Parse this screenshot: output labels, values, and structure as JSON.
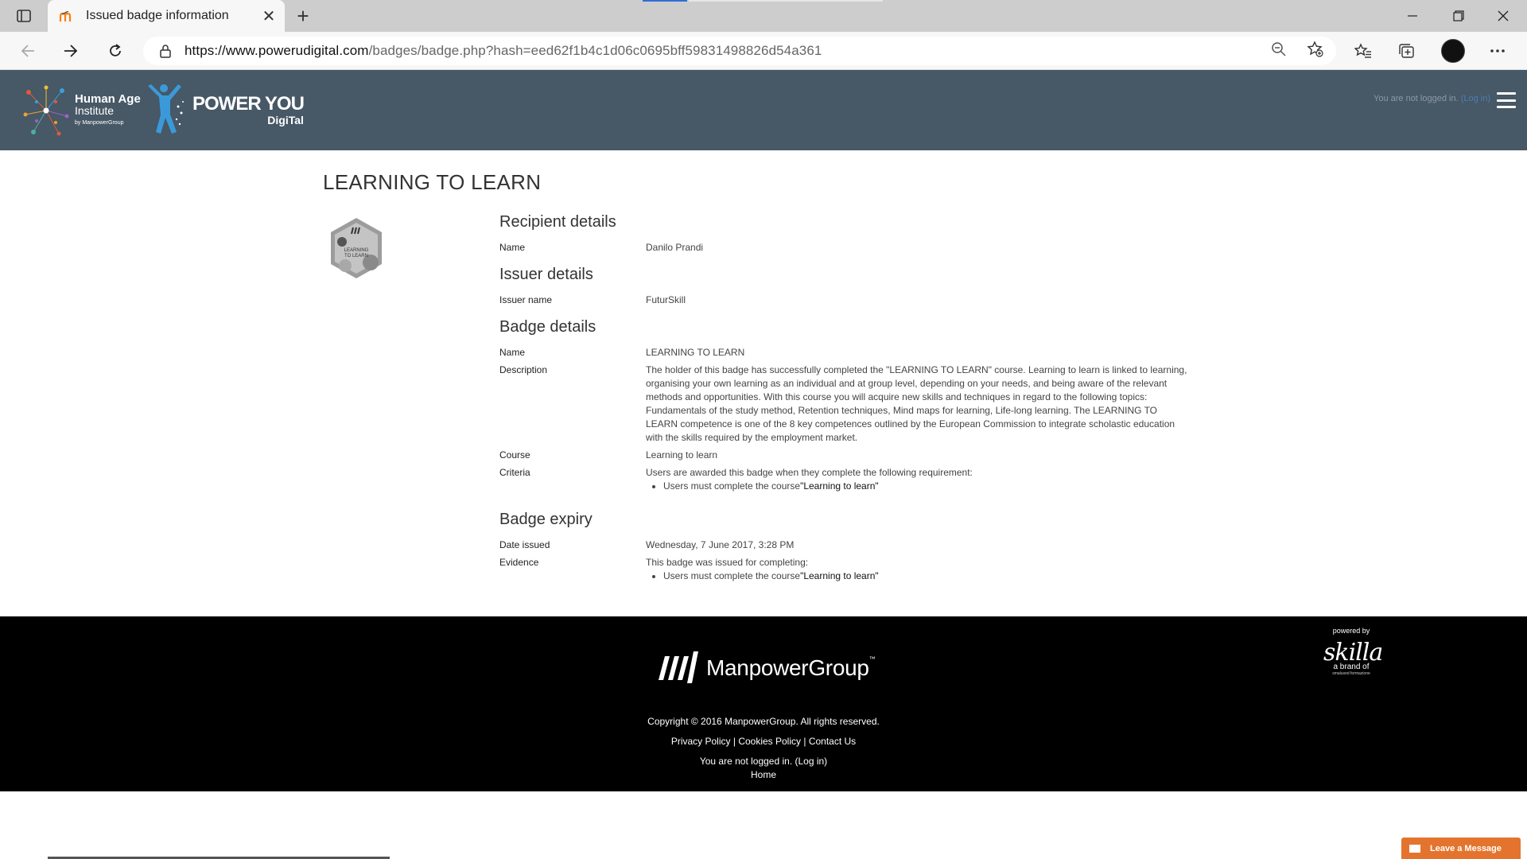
{
  "browser": {
    "tab_title": "Issued badge information",
    "url_host": "https://www.powerudigital.com",
    "url_path": "/badges/badge.php?hash=eed62f1b4c1d06c0695bff59831498826d54a361",
    "new_tab_label": "+",
    "close_tab_label": "✕"
  },
  "header": {
    "hai_line1": "Human Age",
    "hai_line2": "Institute",
    "hai_line3": "by ManpowerGroup",
    "py_main": "POWER YOU",
    "py_sub": "DigiTal",
    "login_text": "You are not logged in.",
    "login_link": "(Log in)"
  },
  "page": {
    "title": "LEARNING TO LEARN",
    "badge_image_text": "LEARNING TO LEARN"
  },
  "recipient": {
    "heading": "Recipient details",
    "name_label": "Name",
    "name_value": "Danilo Prandi"
  },
  "issuer": {
    "heading": "Issuer details",
    "name_label": "Issuer name",
    "name_value": "FuturSkill"
  },
  "badge": {
    "heading": "Badge details",
    "name_label": "Name",
    "name_value": "LEARNING TO LEARN",
    "description_label": "Description",
    "description_value": "The holder of this badge has successfully completed the \"LEARNING TO LEARN\" course. Learning to learn is linked to learning, organising your own learning as an individual and at group level, depending on your needs, and being aware of the relevant methods and opportunities. With this course you will acquire new skills and techniques in regard to the following topics: Fundamentals of the study method, Retention techniques, Mind maps for learning, Life-long learning. The LEARNING TO LEARN competence is one of the 8 key competences outlined by the European Commission to integrate scholastic education with the skills required by the employment market.",
    "course_label": "Course",
    "course_value": "Learning to learn",
    "criteria_label": "Criteria",
    "criteria_intro": "Users are awarded this badge when they complete the following requirement:",
    "criteria_item_prefix": "Users must complete the course",
    "criteria_item_course": "\"Learning to learn\""
  },
  "expiry": {
    "heading": "Badge expiry",
    "date_label": "Date issued",
    "date_value": "Wednesday, 7 June 2017, 3:28 PM",
    "evidence_label": "Evidence",
    "evidence_intro": "This badge was issued for completing:",
    "evidence_item_prefix": "Users must complete the course",
    "evidence_item_course": "\"Learning to learn\""
  },
  "footer": {
    "brand": "ManpowerGroup",
    "tm": "™",
    "copyright": "Copyright © 2016 ManpowerGroup. All rights reserved.",
    "privacy": "Privacy Policy",
    "cookies": "Cookies Policy",
    "contact": "Contact Us",
    "separator": " | ",
    "login_text": "You are not logged in. (Log in)",
    "home": "Home",
    "powered_by": "powered by",
    "skilla": "skilla",
    "brand_of": "a brand of",
    "brand_sub": "smaluxed formazione"
  },
  "chat": {
    "label": "Leave a Message"
  },
  "colors": {
    "header_bg": "#475866",
    "footer_bg": "#000000",
    "chat_bg": "#e4742d",
    "link": "#4a7fb0"
  }
}
